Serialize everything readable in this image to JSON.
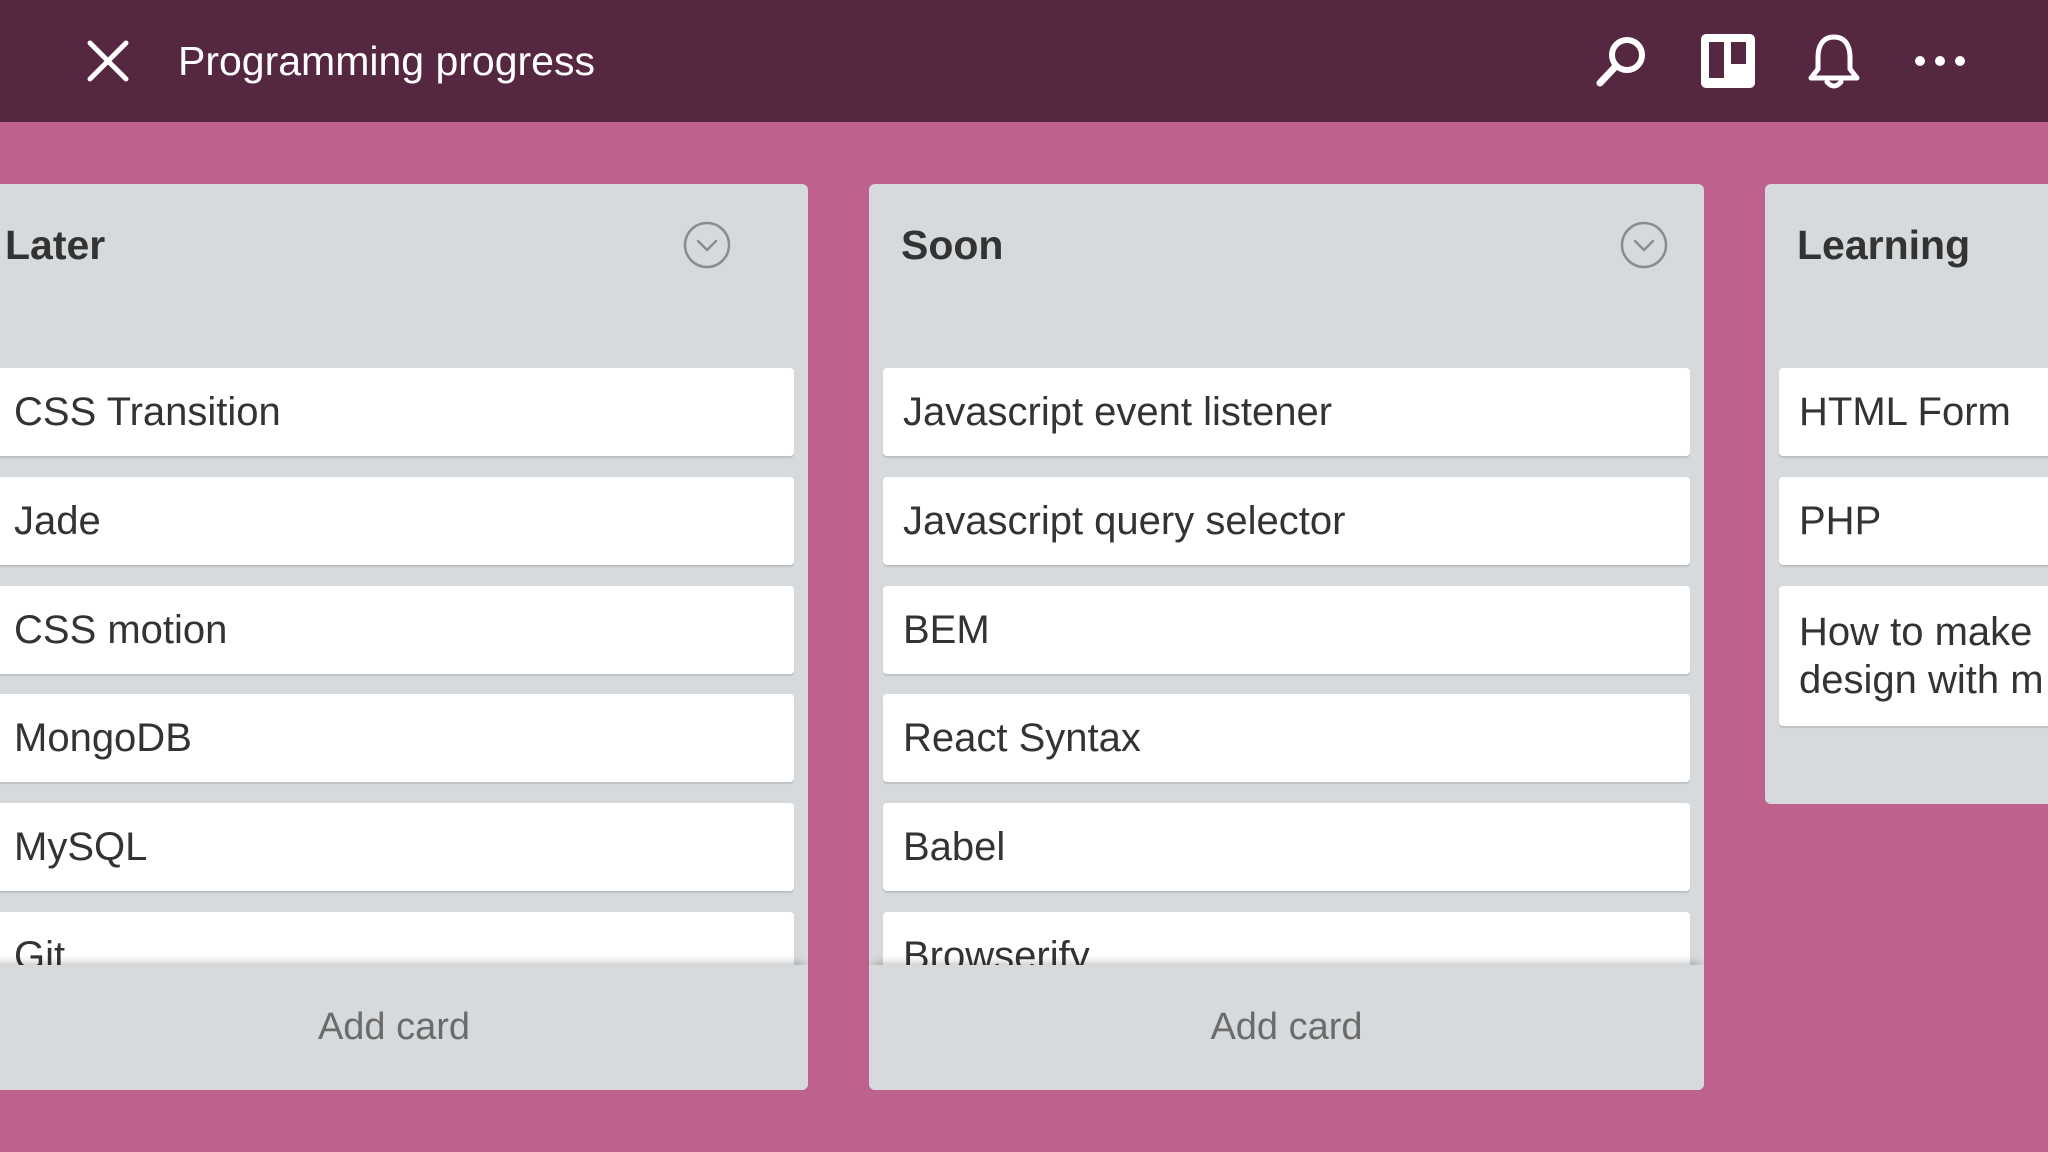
{
  "header": {
    "title": "Programming progress",
    "close_icon": "close-icon",
    "search_icon": "search-icon",
    "board_icon": "board-icon",
    "bell_icon": "bell-icon",
    "more_icon": "more-icon"
  },
  "colors": {
    "topbar": "#562741",
    "board_background": "#bf618d",
    "list_background": "#d6dadc",
    "card_background": "#ffffff"
  },
  "lists": [
    {
      "title": "Later",
      "cards": [
        "CSS Transition",
        "Jade",
        "CSS motion",
        "MongoDB",
        "MySQL",
        "Git"
      ],
      "add_card_label": "Add card"
    },
    {
      "title": "Soon",
      "cards": [
        "Javascript event listener",
        "Javascript query selector",
        "BEM",
        "React Syntax",
        "Babel",
        "Browserify"
      ],
      "add_card_label": "Add card"
    },
    {
      "title": "Learning",
      "cards": [
        "HTML Form",
        "PHP",
        "How to make design with m"
      ]
    }
  ]
}
